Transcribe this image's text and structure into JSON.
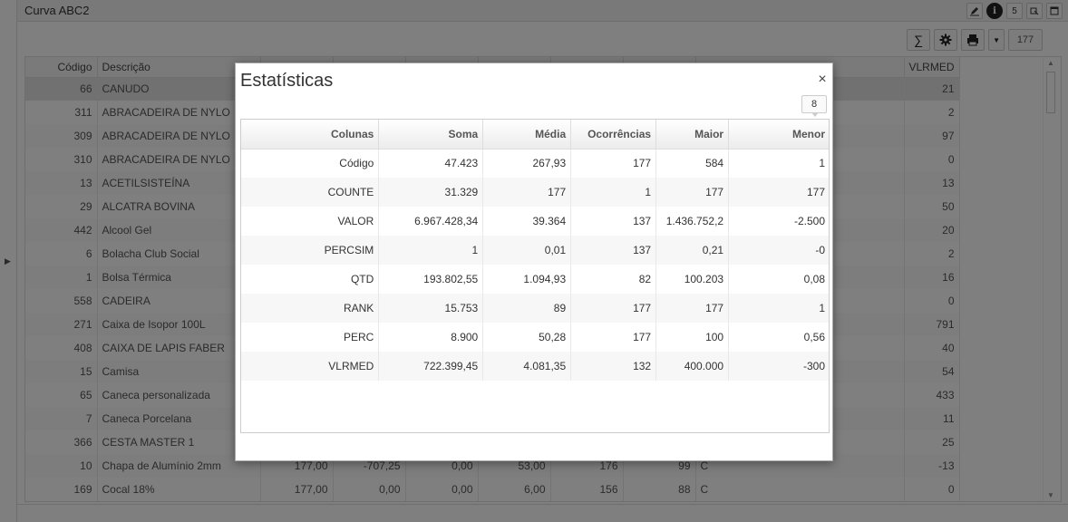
{
  "window": {
    "title": "Curva ABC2",
    "icons": [
      "pencil-icon",
      "info-icon",
      "tool-5",
      "tool-export",
      "tool-window"
    ],
    "icon_labels": {
      "info": "i",
      "five": "5"
    }
  },
  "toolbar": {
    "sum_label": "∑",
    "record_count": "177"
  },
  "grid": {
    "columns": {
      "code": "Código",
      "description": "Descrição",
      "vlrmed": "VLRMED"
    },
    "rows": [
      {
        "code": "66",
        "description": "CANUDO",
        "c1": "",
        "c2": "",
        "c3": "",
        "c4": "",
        "c5": "",
        "c6": "",
        "c7": "",
        "vlrmed": "21"
      },
      {
        "code": "311",
        "description": "ABRACADEIRA DE NYLO",
        "c1": "",
        "c2": "",
        "c3": "",
        "c4": "",
        "c5": "",
        "c6": "",
        "c7": "",
        "vlrmed": "2"
      },
      {
        "code": "309",
        "description": "ABRACADEIRA DE NYLO",
        "c1": "",
        "c2": "",
        "c3": "",
        "c4": "",
        "c5": "",
        "c6": "",
        "c7": "",
        "vlrmed": "97"
      },
      {
        "code": "310",
        "description": "ABRACADEIRA DE NYLO",
        "c1": "",
        "c2": "",
        "c3": "",
        "c4": "",
        "c5": "",
        "c6": "",
        "c7": "",
        "vlrmed": "0"
      },
      {
        "code": "13",
        "description": "ACETILSISTEÍNA",
        "c1": "",
        "c2": "",
        "c3": "",
        "c4": "",
        "c5": "",
        "c6": "",
        "c7": "",
        "vlrmed": "13"
      },
      {
        "code": "29",
        "description": "ALCATRA BOVINA",
        "c1": "",
        "c2": "",
        "c3": "",
        "c4": "",
        "c5": "",
        "c6": "",
        "c7": "",
        "vlrmed": "50"
      },
      {
        "code": "442",
        "description": "Alcool Gel",
        "c1": "",
        "c2": "",
        "c3": "",
        "c4": "",
        "c5": "",
        "c6": "",
        "c7": "",
        "vlrmed": "20"
      },
      {
        "code": "6",
        "description": "Bolacha Club Social",
        "c1": "",
        "c2": "",
        "c3": "",
        "c4": "",
        "c5": "",
        "c6": "",
        "c7": "",
        "vlrmed": "2"
      },
      {
        "code": "1",
        "description": "Bolsa Térmica",
        "c1": "",
        "c2": "",
        "c3": "",
        "c4": "",
        "c5": "",
        "c6": "",
        "c7": "",
        "vlrmed": "16"
      },
      {
        "code": "558",
        "description": "CADEIRA",
        "c1": "",
        "c2": "",
        "c3": "",
        "c4": "",
        "c5": "",
        "c6": "",
        "c7": "",
        "vlrmed": "0"
      },
      {
        "code": "271",
        "description": "Caixa de Isopor 100L",
        "c1": "",
        "c2": "",
        "c3": "",
        "c4": "",
        "c5": "",
        "c6": "",
        "c7": "",
        "vlrmed": "791"
      },
      {
        "code": "408",
        "description": "CAIXA DE LAPIS FABER",
        "c1": "",
        "c2": "",
        "c3": "",
        "c4": "",
        "c5": "",
        "c6": "",
        "c7": "",
        "vlrmed": "40"
      },
      {
        "code": "15",
        "description": "Camisa",
        "c1": "",
        "c2": "",
        "c3": "",
        "c4": "",
        "c5": "",
        "c6": "",
        "c7": "",
        "vlrmed": "54"
      },
      {
        "code": "65",
        "description": "Caneca personalizada",
        "c1": "",
        "c2": "",
        "c3": "",
        "c4": "",
        "c5": "",
        "c6": "",
        "c7": "",
        "vlrmed": "433"
      },
      {
        "code": "7",
        "description": "Caneca Porcelana",
        "c1": "",
        "c2": "",
        "c3": "",
        "c4": "",
        "c5": "",
        "c6": "",
        "c7": "",
        "vlrmed": "11"
      },
      {
        "code": "366",
        "description": "CESTA MASTER 1",
        "c1": "",
        "c2": "",
        "c3": "",
        "c4": "",
        "c5": "",
        "c6": "",
        "c7": "",
        "vlrmed": "25"
      },
      {
        "code": "10",
        "description": "Chapa de Alumínio 2mm",
        "c1": "177,00",
        "c2": "-707,25",
        "c3": "0,00",
        "c4": "53,00",
        "c5": "176",
        "c6": "99",
        "c7": "C",
        "vlrmed": "-13"
      },
      {
        "code": "169",
        "description": "Cocal 18%",
        "c1": "177,00",
        "c2": "0,00",
        "c3": "0,00",
        "c4": "6,00",
        "c5": "156",
        "c6": "88",
        "c7": "C",
        "vlrmed": "0"
      }
    ]
  },
  "modal": {
    "title": "Estatísticas",
    "close_label": "×",
    "badge": "8",
    "headers": {
      "col": "Colunas",
      "sum": "Soma",
      "avg": "Média",
      "occ": "Ocorrências",
      "max": "Maior",
      "min": "Menor"
    },
    "rows": [
      {
        "col": "Código",
        "sum": "47.423",
        "avg": "267,93",
        "occ": "177",
        "max": "584",
        "min": "1"
      },
      {
        "col": "COUNTE",
        "sum": "31.329",
        "avg": "177",
        "occ": "1",
        "max": "177",
        "min": "177"
      },
      {
        "col": "VALOR",
        "sum": "6.967.428,34",
        "avg": "39.364",
        "occ": "137",
        "max": "1.436.752,2",
        "min": "-2.500"
      },
      {
        "col": "PERCSIM",
        "sum": "1",
        "avg": "0,01",
        "occ": "137",
        "max": "0,21",
        "min": "-0"
      },
      {
        "col": "QTD",
        "sum": "193.802,55",
        "avg": "1.094,93",
        "occ": "82",
        "max": "100.203",
        "min": "0,08"
      },
      {
        "col": "RANK",
        "sum": "15.753",
        "avg": "89",
        "occ": "177",
        "max": "177",
        "min": "1"
      },
      {
        "col": "PERC",
        "sum": "8.900",
        "avg": "50,28",
        "occ": "177",
        "max": "100",
        "min": "0,56"
      },
      {
        "col": "VLRMED",
        "sum": "722.399,45",
        "avg": "4.081,35",
        "occ": "132",
        "max": "400.000",
        "min": "-300"
      }
    ]
  },
  "colors": {
    "overlay": "#000000",
    "modal_bg": "#ffffff",
    "selected_row": "#e3e3e3"
  }
}
